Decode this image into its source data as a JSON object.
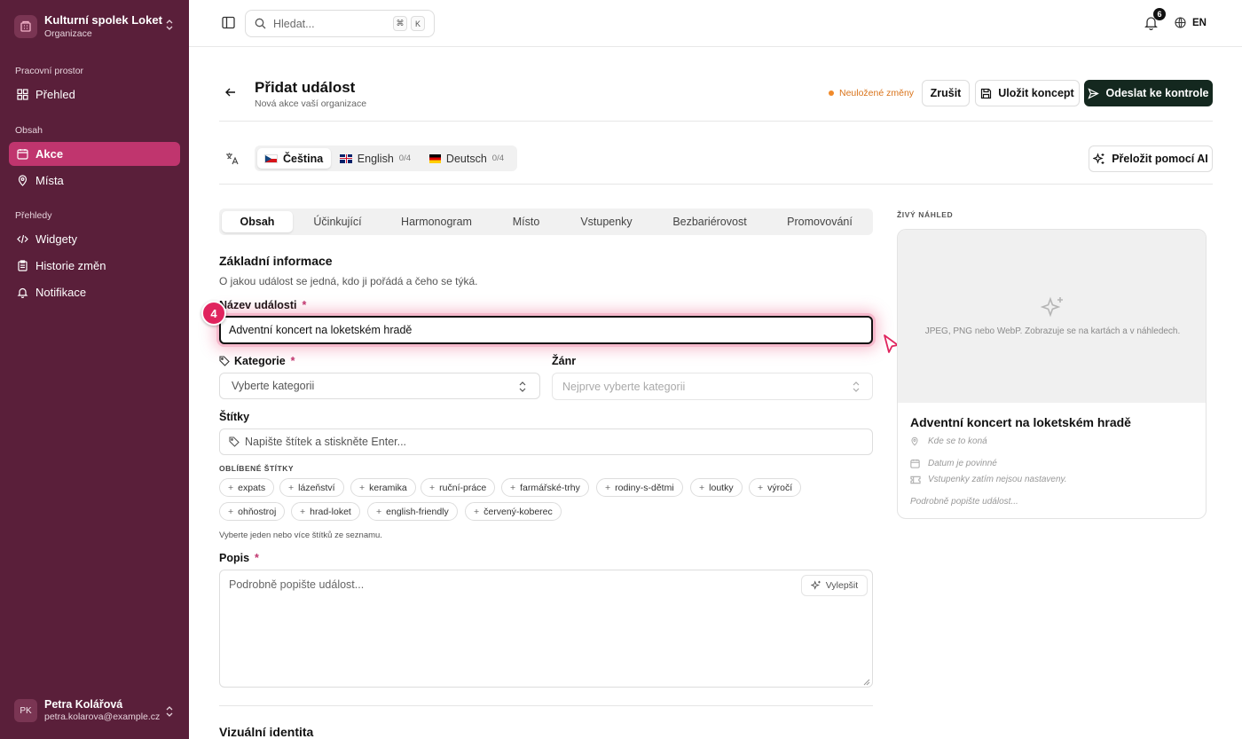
{
  "sidebar": {
    "org_name": "Kulturní spolek Loket",
    "org_sub": "Organizace",
    "sections": [
      {
        "label": "Pracovní prostor"
      },
      {
        "label": "Obsah"
      },
      {
        "label": "Přehledy"
      }
    ],
    "items": [
      {
        "label": "Přehled",
        "icon": "grid-icon"
      },
      {
        "label": "Akce",
        "icon": "calendar-icon",
        "active": true
      },
      {
        "label": "Místa",
        "icon": "map-pin-icon"
      },
      {
        "label": "Widgety",
        "icon": "code-icon"
      },
      {
        "label": "Historie změn",
        "icon": "clipboard-icon"
      },
      {
        "label": "Notifikace",
        "icon": "bell-icon"
      }
    ],
    "user": {
      "initials": "PK",
      "name": "Petra Kolářová",
      "email": "petra.kolarova@example.cz"
    }
  },
  "topbar": {
    "search_placeholder": "Hledat...",
    "kbd_1": "⌘",
    "kbd_2": "K",
    "notifications_count": "6",
    "language": "EN"
  },
  "header": {
    "title": "Přidat událost",
    "subtitle": "Nová akce vaší organizace",
    "unsaved": "Neuložené změny",
    "cancel": "Zrušit",
    "save_draft": "Uložit koncept",
    "submit": "Odeslat ke kontrole"
  },
  "lang_tabs": [
    {
      "label": "Čeština",
      "count": "",
      "active": true
    },
    {
      "label": "English",
      "count": "0/4"
    },
    {
      "label": "Deutsch",
      "count": "0/4"
    }
  ],
  "translate_ai": "Přeložit pomocí AI",
  "section_tabs": [
    "Obsah",
    "Účinkující",
    "Harmonogram",
    "Místo",
    "Vstupenky",
    "Bezbariérovost",
    "Promovování"
  ],
  "form": {
    "section_title": "Základní informace",
    "section_desc": "O jakou událost se jedná, kdo ji pořádá a čeho se týká.",
    "name_label": "Název události",
    "name_value": "Adventní koncert na loketském hradě",
    "step": "4",
    "category_label": "Kategorie",
    "category_placeholder": "Vyberte kategorii",
    "genre_label": "Žánr",
    "genre_placeholder": "Nejprve vyberte kategorii",
    "tags_label": "Štítky",
    "tags_placeholder": "Napište štítek a stiskněte Enter...",
    "popular_tags_label": "OBLÍBENÉ ŠTÍTKY",
    "popular_tags": [
      "expats",
      "lázeňství",
      "keramika",
      "ruční-práce",
      "farmářské-trhy",
      "rodiny-s-dětmi",
      "loutky",
      "výročí",
      "ohňostroj",
      "hrad-loket",
      "english-friendly",
      "červený-koberec"
    ],
    "tags_help": "Vyberte jeden nebo více štítků ze seznamu.",
    "description_label": "Popis",
    "description_placeholder": "Podrobně popište událost...",
    "improve": "Vylepšit",
    "visual_title": "Vizuální identita"
  },
  "preview": {
    "label": "ŽIVÝ NÁHLED",
    "image_hint": "JPEG, PNG nebo WebP. Zobrazuje se na kartách a v náhledech.",
    "title": "Adventní koncert na loketském hradě",
    "location": "Kde se to koná",
    "date": "Datum je povinné",
    "tickets": "Vstupenky zatím nejsou nastaveny.",
    "description": "Podrobně popište událost..."
  },
  "colors": {
    "sidebar_bg": "#5a1f3a",
    "accent": "#c0356e",
    "primary_button": "#14281f",
    "warning": "#d9731a"
  }
}
